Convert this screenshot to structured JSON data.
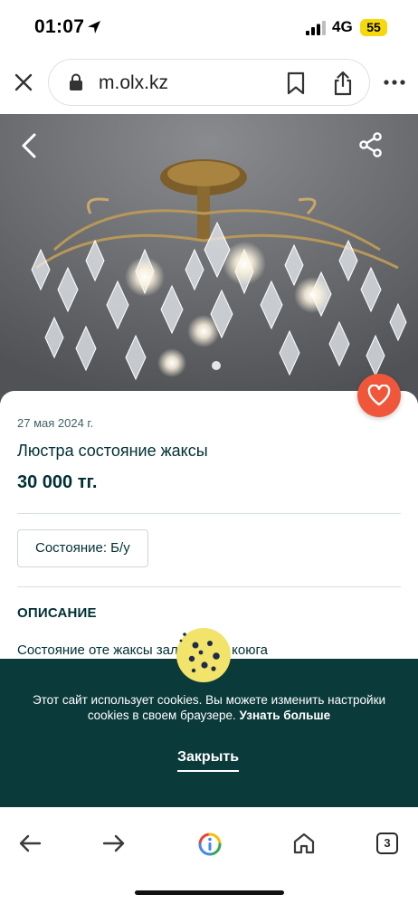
{
  "status_bar": {
    "time": "01:07",
    "network": "4G",
    "battery": "55"
  },
  "browser": {
    "url": "m.olx.kz",
    "tab_count": "3"
  },
  "listing": {
    "posted_date": "27 мая 2024 г.",
    "title": "Люстра состояние жаксы",
    "price": "30 000 тг.",
    "condition": "Состояние: Б/у",
    "description_heading": "ОПИСАНИЕ",
    "description_visible": "Состояние оте жаксы         залга,холга коюга"
  },
  "cookie_banner": {
    "text": "Этот сайт использует cookies. Вы можете изменить настройки cookies в своем браузере.",
    "link_label": "Узнать больше",
    "close_label": "Закрыть"
  },
  "colors": {
    "brand_dark": "#002f34",
    "banner_bg": "#0b3a3a",
    "favorite": "#f0573a",
    "battery": "#f5d90a"
  },
  "icons": [
    "location-arrow-icon",
    "signal-icon",
    "close-icon",
    "lock-icon",
    "bookmark-icon",
    "share-icon",
    "more-icon",
    "chevron-left-icon",
    "share-network-icon",
    "heart-icon",
    "cookie-icon",
    "arrow-left-icon",
    "arrow-right-icon",
    "google-lens-icon",
    "home-icon"
  ]
}
